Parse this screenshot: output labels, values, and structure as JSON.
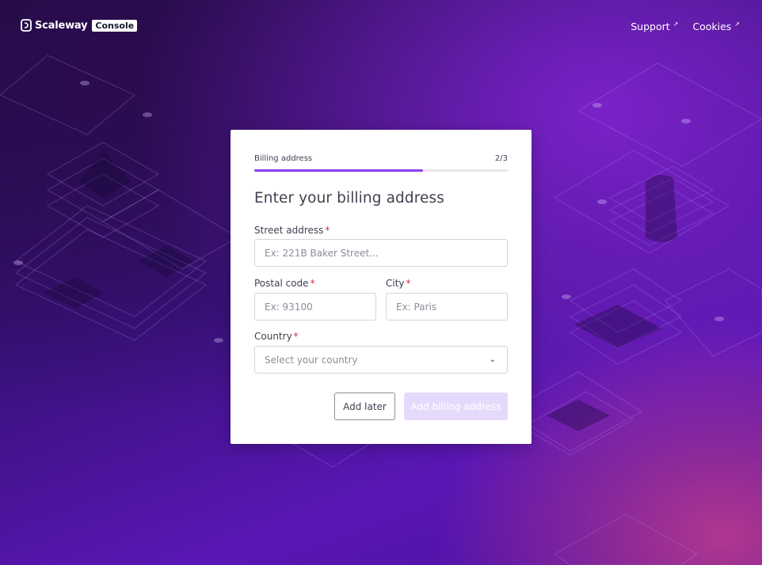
{
  "header": {
    "brand": "Scaleway",
    "brand_badge": "Console",
    "links": [
      {
        "label": "Support",
        "icon": "external-link-icon"
      },
      {
        "label": "Cookies",
        "icon": "external-link-icon"
      }
    ]
  },
  "form": {
    "step_label": "Billing address",
    "step_count": "2/3",
    "progress_fraction": 0.667,
    "title": "Enter your billing address",
    "required_marker": "*",
    "street": {
      "label": "Street address",
      "placeholder": "Ex: 221B Baker Street..."
    },
    "postal": {
      "label": "Postal code",
      "placeholder": "Ex: 93100"
    },
    "city": {
      "label": "City",
      "placeholder": "Ex: Paris"
    },
    "country": {
      "label": "Country",
      "placeholder": "Select your country",
      "icon": "chevron-down-icon"
    },
    "add_later": "Add later",
    "submit": "Add billing address"
  },
  "colors": {
    "accent": "#8c40ef",
    "required": "#d12f41",
    "disabled_button": "#e5dafb",
    "text": "#3f4250"
  }
}
